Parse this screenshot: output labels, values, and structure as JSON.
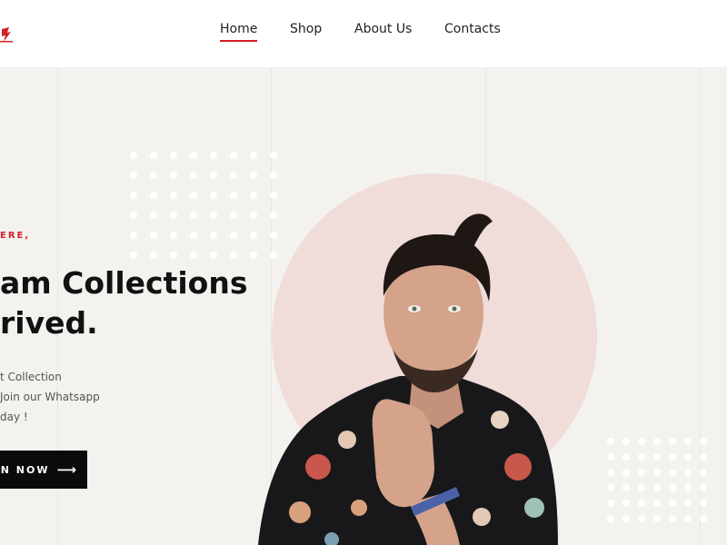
{
  "nav": {
    "items": [
      {
        "label": "Home",
        "active": true
      },
      {
        "label": "Shop",
        "active": false
      },
      {
        "label": "About Us",
        "active": false
      },
      {
        "label": "Contacts",
        "active": false
      }
    ]
  },
  "hero": {
    "eyebrow": "ERE,",
    "headline_line1": "am Collections",
    "headline_line2": "rived.",
    "desc_line1": "t Collection",
    "desc_line2": "Join our Whatsapp",
    "desc_line3": "day !",
    "cta_label": "N NOW",
    "cta_icon": "arrow-right-icon"
  },
  "colors": {
    "accent": "#d42128",
    "hero_bg": "#f3f2ef",
    "circle": "#f0dcd9",
    "cta_bg": "#0b0b0b"
  }
}
